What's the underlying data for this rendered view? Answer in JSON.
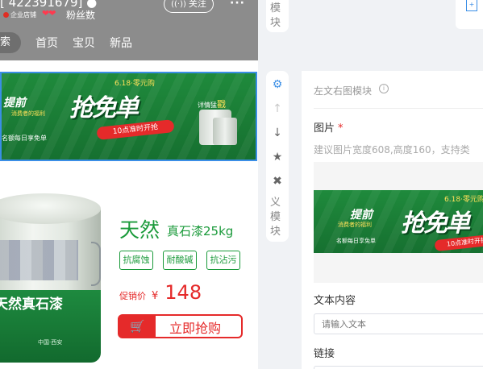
{
  "shop": {
    "name": "[ 422391679] ●",
    "badge_text": "企业店铺",
    "hearts": "❤❤",
    "fans_label": "粉丝数",
    "follow_label": "关注",
    "follow_icon": "wave-icon",
    "more_label": "···"
  },
  "nav": {
    "search_label": "索",
    "tabs": [
      "首页",
      "宝贝",
      "新品"
    ]
  },
  "banner": {
    "badge_top": "6.18·零元购",
    "pre_text": "提前",
    "pre_sub": "消费者的福利",
    "main_text": "抢免单",
    "pill_text": "10点准时开抢",
    "left_small": "名额每日享免单",
    "detail_text": "详情猛",
    "detail_emph": "戳"
  },
  "product": {
    "can_label": "天然真石漆",
    "can_origin": "中国·西安",
    "title": "天然",
    "subtitle": "真石漆25kg",
    "tags": [
      "抗腐蚀",
      "耐酸碱",
      "抗沾污"
    ],
    "price_label": "促销价",
    "currency": "¥",
    "price": "148",
    "buy_label": "立即抢购",
    "cart_icon": "cart-icon"
  },
  "modules": {
    "top_text": "模\n块",
    "bottom_text": "义\n模\n块",
    "tools": [
      {
        "icon": "gear-icon",
        "glyph": "⚙"
      },
      {
        "icon": "arrow-up-icon",
        "glyph": "↑"
      },
      {
        "icon": "arrow-down-icon",
        "glyph": "↓"
      },
      {
        "icon": "star-icon",
        "glyph": "★"
      },
      {
        "icon": "trash-icon",
        "glyph": "✖"
      }
    ]
  },
  "panel": {
    "title": "左文右图模块",
    "info_glyph": "i",
    "image_label": "图片",
    "required_mark": "*",
    "image_hint": "建议图片宽度608,高度160，支持类",
    "text_label": "文本内容",
    "text_placeholder": "请输入文本",
    "link_label": "链接"
  },
  "colors": {
    "accent_blue": "#3a8ee6",
    "brand_green": "#1a9a3a",
    "price_red": "#e52a2a",
    "header_gray": "#8c8c8c"
  }
}
